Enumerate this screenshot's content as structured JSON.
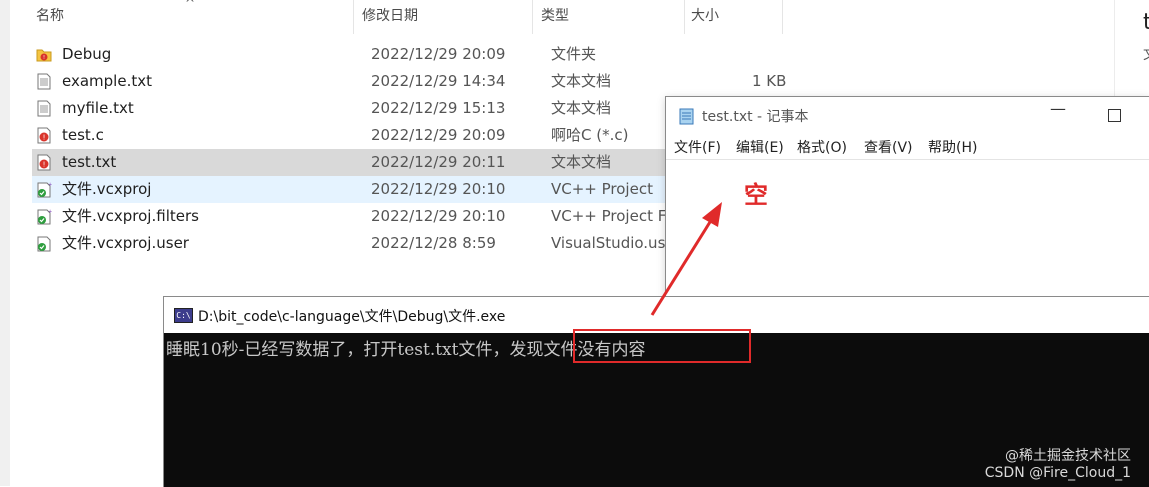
{
  "explorer": {
    "columns": {
      "name": "名称",
      "modified": "修改日期",
      "type": "类型",
      "size": "大小"
    },
    "files": [
      {
        "name": "Debug",
        "modified": "2022/12/29 20:09",
        "type": "文件夹",
        "size": "",
        "icon": "folder-icon"
      },
      {
        "name": "example.txt",
        "modified": "2022/12/29 14:34",
        "type": "文本文档",
        "size": "1 KB",
        "icon": "text-file-icon"
      },
      {
        "name": "myfile.txt",
        "modified": "2022/12/29 15:13",
        "type": "文本文档",
        "size": "",
        "icon": "text-file-icon"
      },
      {
        "name": "test.c",
        "modified": "2022/12/29 20:09",
        "type": "啊哈C (*.c)",
        "size": "",
        "icon": "c-source-file-icon"
      },
      {
        "name": "test.txt",
        "modified": "2022/12/29 20:11",
        "type": "文本文档",
        "size": "",
        "icon": "text-file-icon"
      },
      {
        "name": "文件.vcxproj",
        "modified": "2022/12/29 20:10",
        "type": "VC++ Project",
        "size": "",
        "icon": "vcxproj-file-icon"
      },
      {
        "name": "文件.vcxproj.filters",
        "modified": "2022/12/29 20:10",
        "type": "VC++ Project Fil...",
        "size": "",
        "icon": "vcxproj-file-icon"
      },
      {
        "name": "文件.vcxproj.user",
        "modified": "2022/12/28 8:59",
        "type": "VisualStudio.use...",
        "size": "",
        "icon": "vs-user-file-icon"
      }
    ],
    "right_pane": {
      "line1": "t",
      "line2": "文"
    }
  },
  "notepad": {
    "title": "test.txt - 记事本",
    "menu": [
      "文件(F)",
      "编辑(E)",
      "格式(O)",
      "查看(V)",
      "帮助(H)"
    ],
    "minimize_glyph": "—",
    "annotation": "空"
  },
  "console": {
    "title": "D:\\bit_code\\c-language\\文件\\Debug\\文件.exe",
    "icon_text": "C:\\",
    "output_prefix": "睡眠10秒-已经写数据了，打开test.txt文件，",
    "output_highlight": "发现文件没有内容"
  },
  "watermark": {
    "line1": "@稀土掘金技术社区",
    "line2": "CSDN @Fire_Cloud_1"
  },
  "colors": {
    "annotation_red": "#e02a2a",
    "selection_gray": "#d9d9d9",
    "hover_blue": "#e5f3ff",
    "console_bg": "#0c0c0c"
  }
}
